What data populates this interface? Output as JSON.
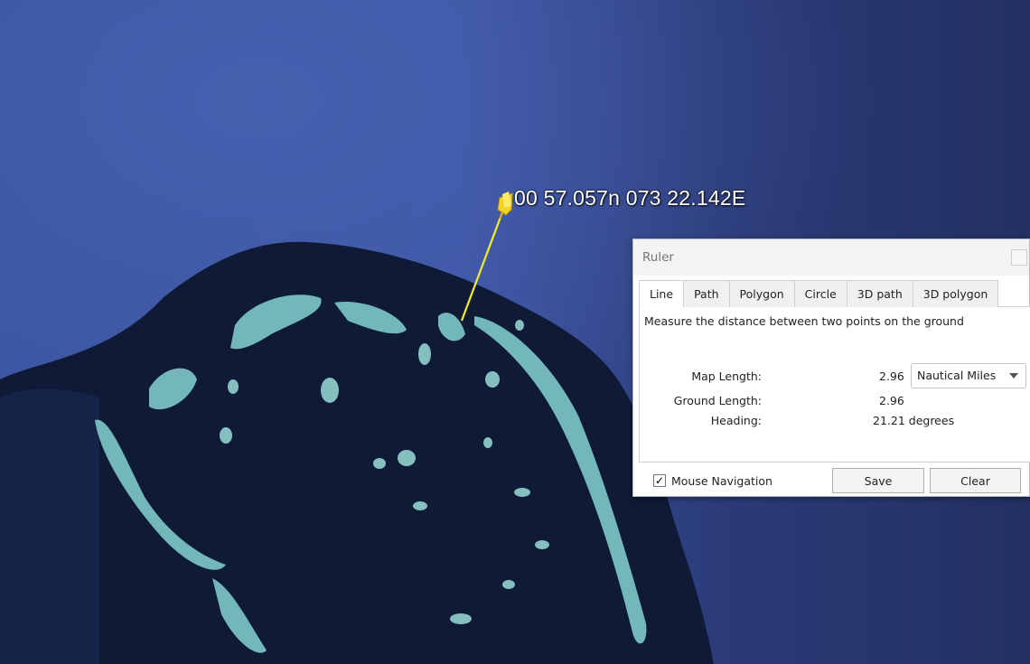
{
  "map": {
    "placemark_label": "00 57.057n 073 22.142E"
  },
  "ruler": {
    "title": "Ruler",
    "tabs": [
      {
        "label": "Line",
        "active": true
      },
      {
        "label": "Path"
      },
      {
        "label": "Polygon"
      },
      {
        "label": "Circle"
      },
      {
        "label": "3D path"
      },
      {
        "label": "3D polygon"
      }
    ],
    "description": "Measure the distance between two points on the ground",
    "map_length_label": "Map Length:",
    "map_length_value": "2.96",
    "units_selected": "Nautical Miles",
    "ground_length_label": "Ground Length:",
    "ground_length_value": "2.96",
    "heading_label": "Heading:",
    "heading_value": "21.21 degrees",
    "mouse_navigation_label": "Mouse Navigation",
    "mouse_navigation_checked": "✓",
    "save_label": "Save",
    "clear_label": "Clear"
  }
}
